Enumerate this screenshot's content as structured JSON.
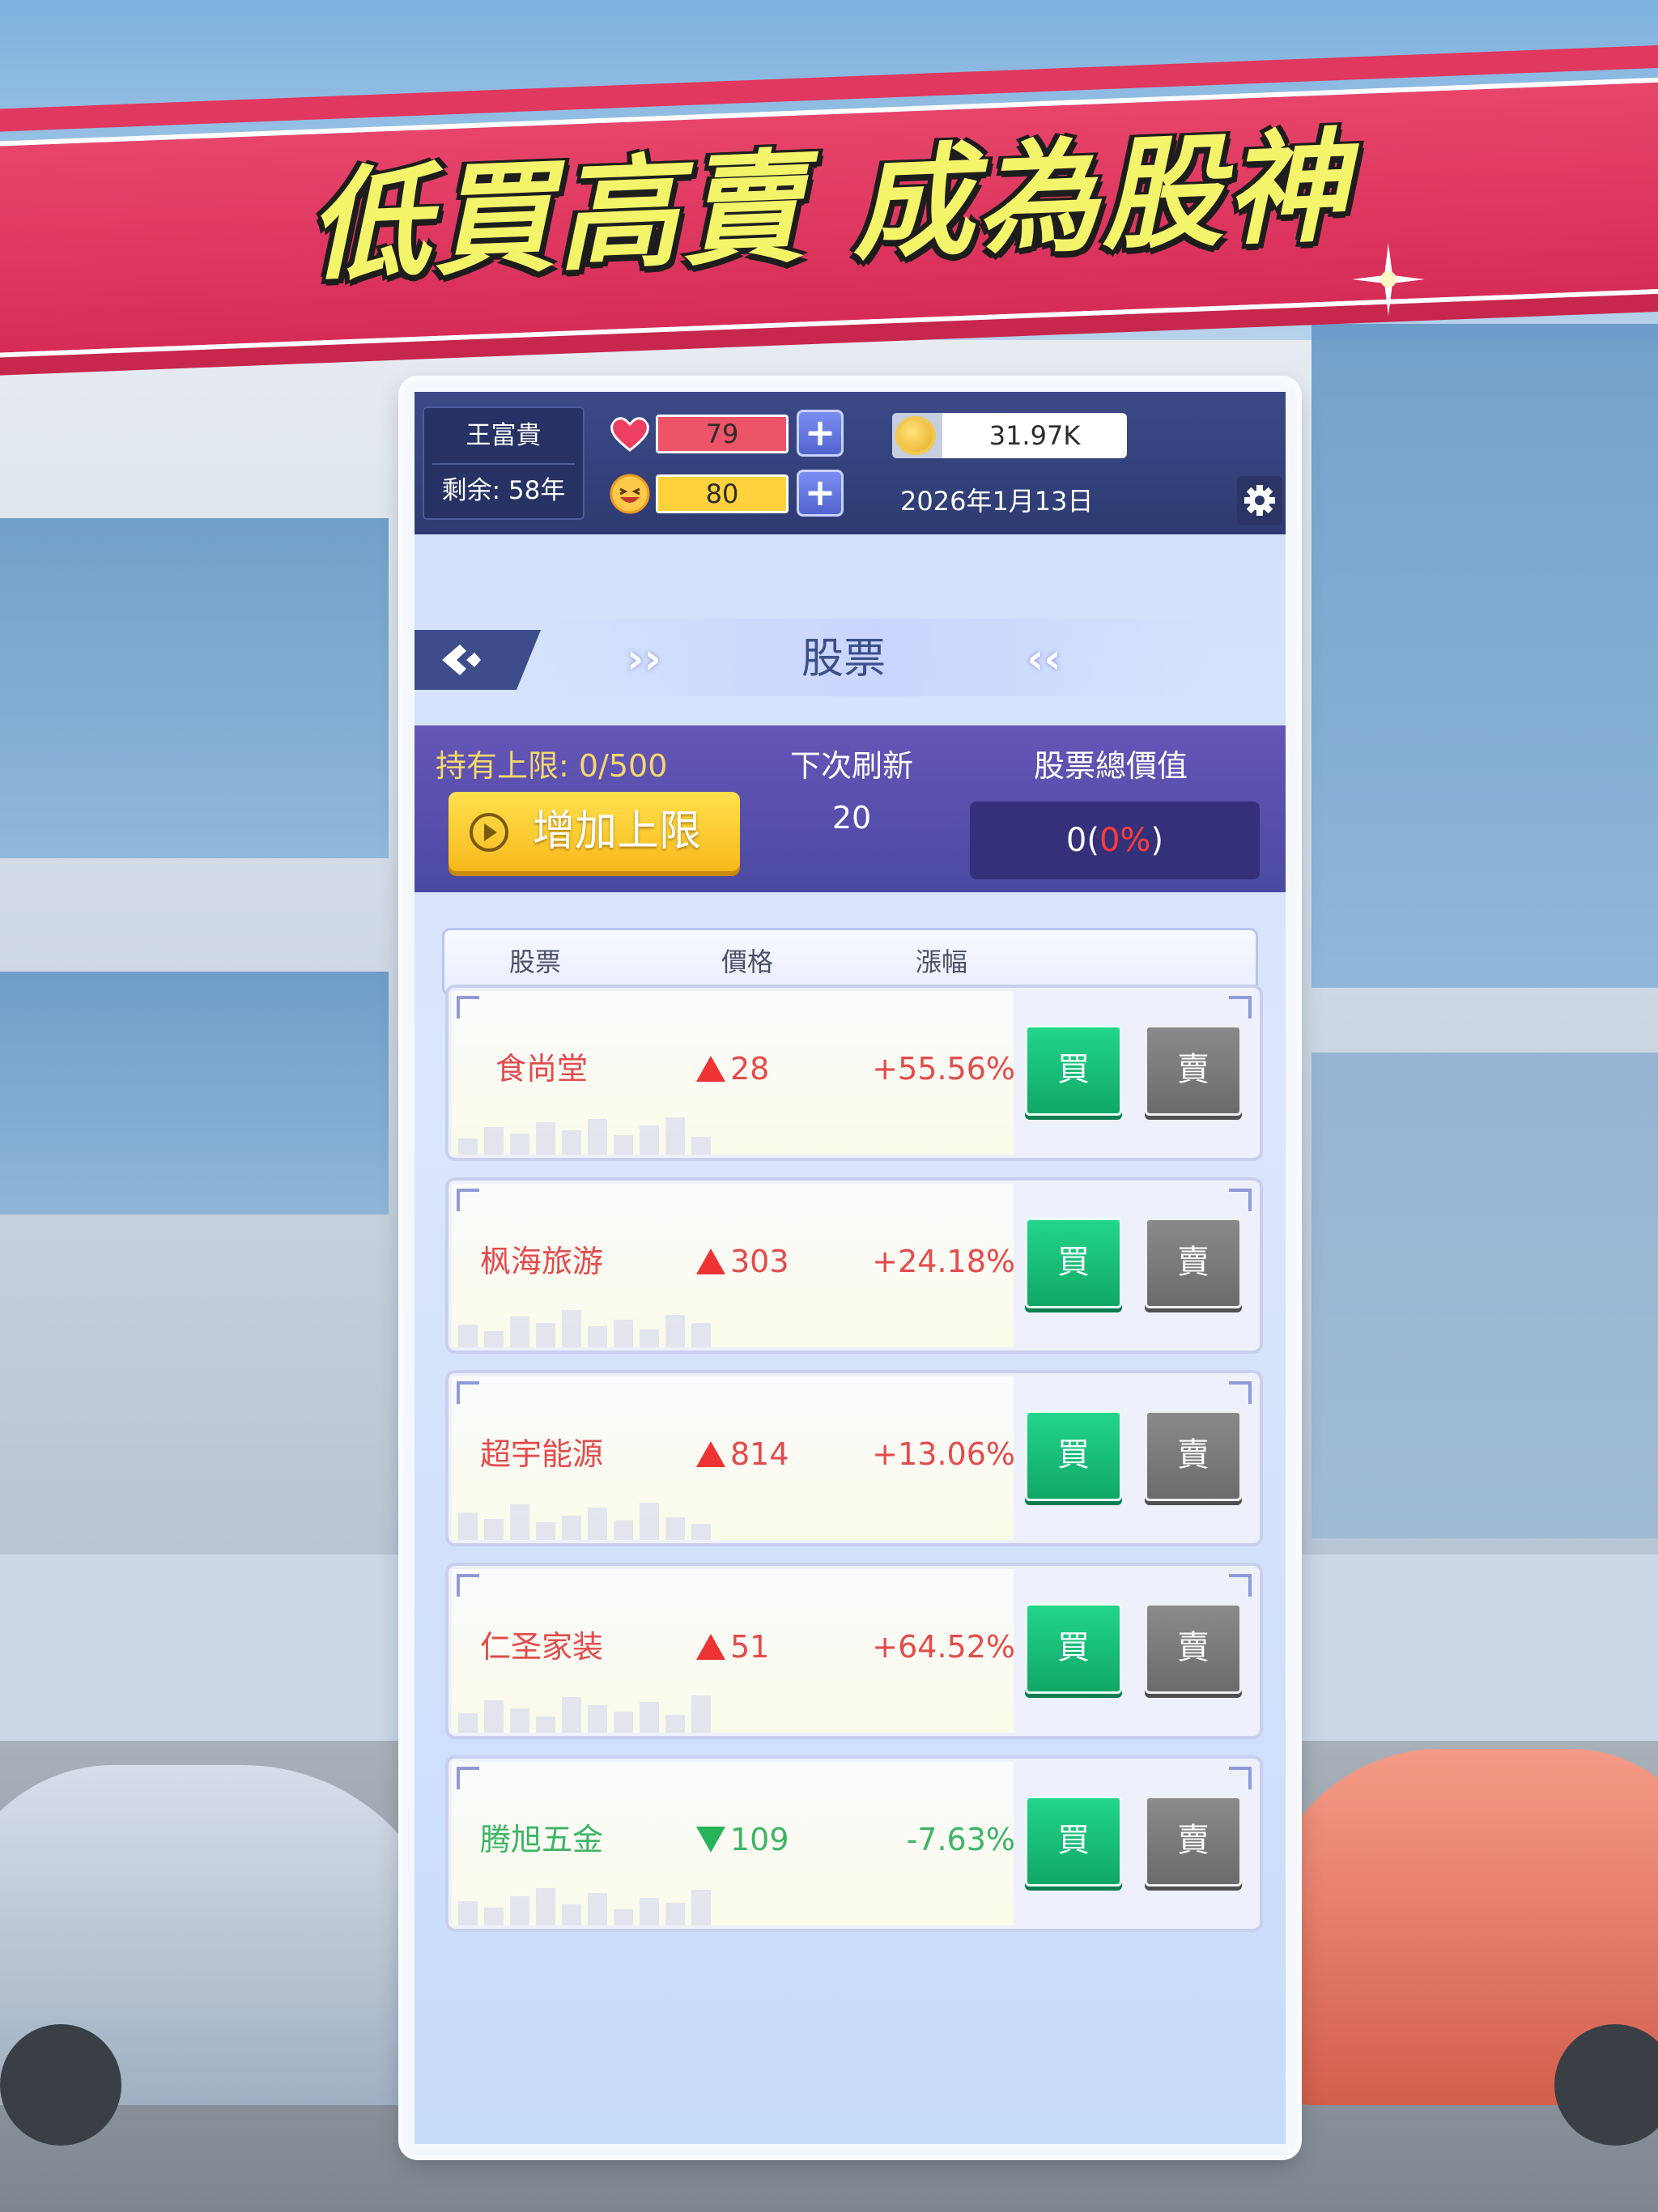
{
  "banner": {
    "title": "低買高賣 成為股神"
  },
  "player": {
    "name": "王富貴",
    "remaining": "剩余: 58年"
  },
  "stats": {
    "health": {
      "value": "79",
      "icon": "heart-icon",
      "color": "#ee5467"
    },
    "happiness": {
      "value": "80",
      "icon": "laughing-face-icon",
      "color": "#ffd23d"
    },
    "plus_label": "+"
  },
  "money": {
    "value": "31.97K",
    "icon": "coin-icon"
  },
  "date": "2026年1月13日",
  "header": {
    "title": "股票",
    "chev_left": "››",
    "chev_right": "‹‹"
  },
  "info": {
    "holding_limit": "持有上限: 0/500",
    "add_limit_button": "增加上限",
    "next_refresh_label": "下次刷新",
    "next_refresh_value": "20",
    "total_value_label": "股票總價值",
    "total_value_amount": "0(",
    "total_value_pct": "0%",
    "total_value_close": ")"
  },
  "table": {
    "columns": [
      "股票",
      "價格",
      "漲幅"
    ],
    "buy_label": "買",
    "sell_label": "賣",
    "rows": [
      {
        "name": "食尚堂",
        "direction": "up",
        "price": "28",
        "change": "+55.56%"
      },
      {
        "name": "枫海旅游",
        "direction": "up",
        "price": "303",
        "change": "+24.18%"
      },
      {
        "name": "超宇能源",
        "direction": "up",
        "price": "814",
        "change": "+13.06%"
      },
      {
        "name": "仁圣家装",
        "direction": "up",
        "price": "51",
        "change": "+64.52%"
      },
      {
        "name": "腾旭五金",
        "direction": "down",
        "price": "109",
        "change": "-7.63%"
      }
    ]
  },
  "colors": {
    "up": "#e44b4b",
    "down": "#3cb465",
    "buy": "#10a768",
    "sell": "#6b6b6b",
    "banner": "#d62c57"
  }
}
